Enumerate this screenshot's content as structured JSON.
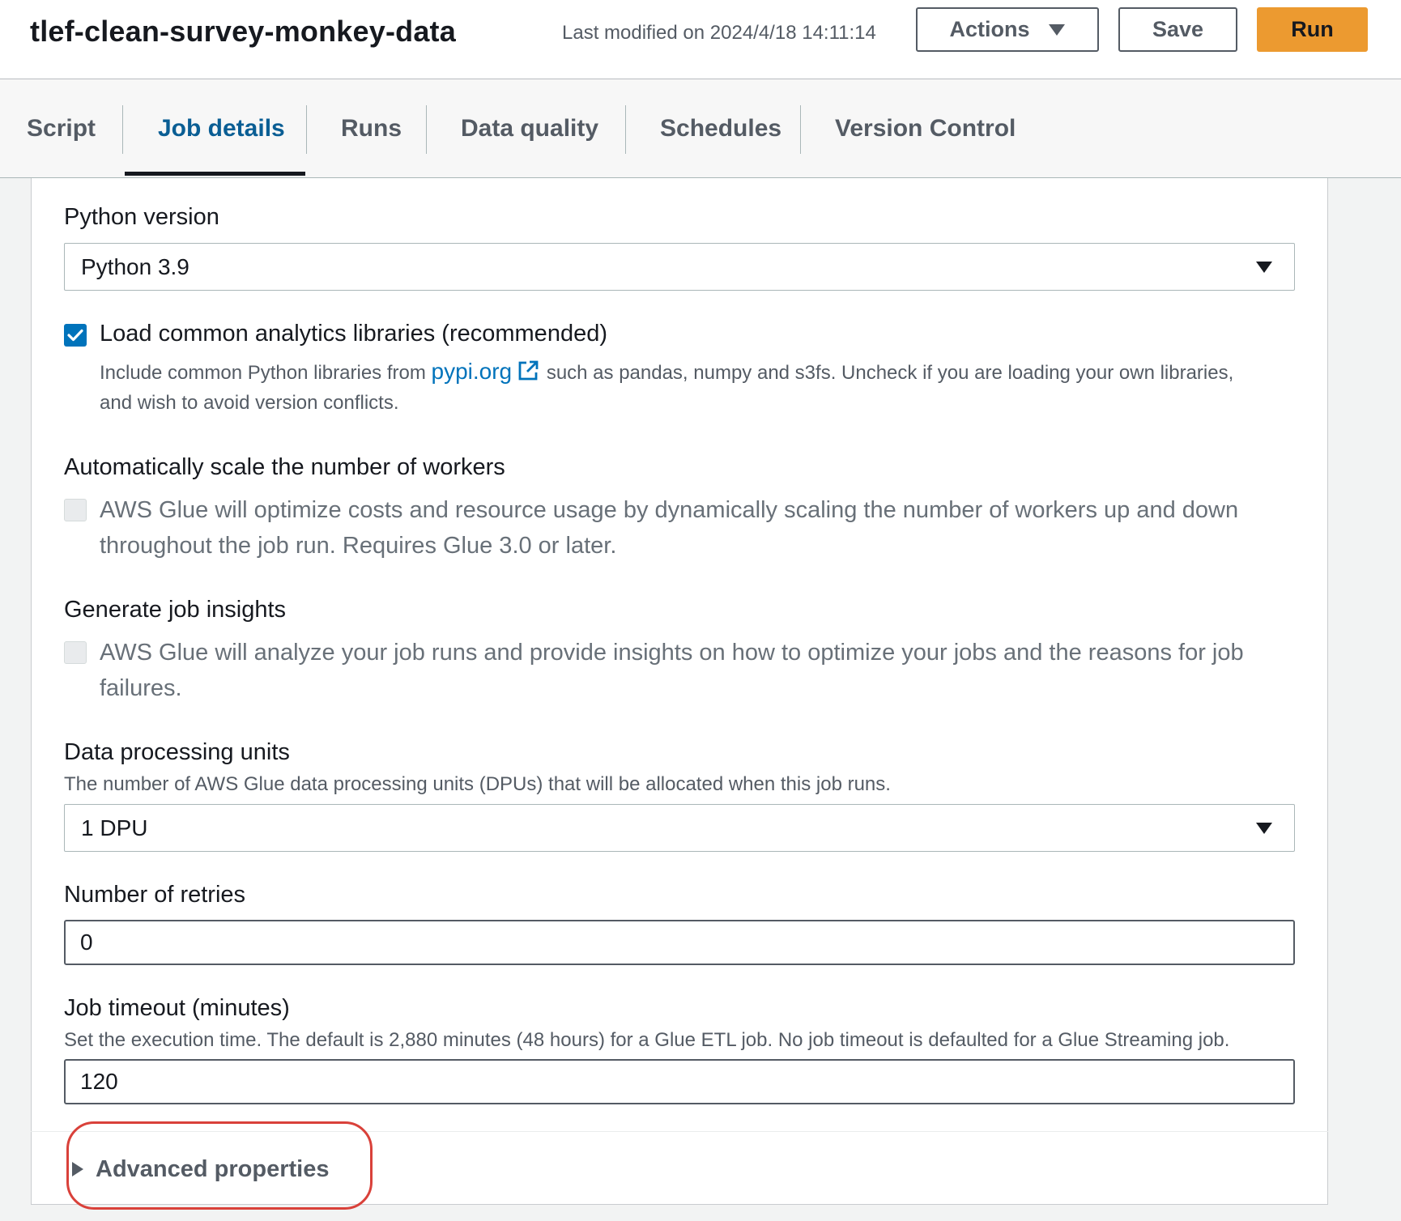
{
  "header": {
    "job_name": "tlef-clean-survey-monkey-data",
    "last_modified": "Last modified on 2024/4/18 14:11:14",
    "actions_label": "Actions",
    "save_label": "Save",
    "run_label": "Run"
  },
  "tabs": [
    {
      "label": "Script",
      "active": false
    },
    {
      "label": "Job details",
      "active": true
    },
    {
      "label": "Runs",
      "active": false
    },
    {
      "label": "Data quality",
      "active": false
    },
    {
      "label": "Schedules",
      "active": false
    },
    {
      "label": "Version Control",
      "active": false
    }
  ],
  "form": {
    "python_version": {
      "label": "Python version",
      "value": "Python 3.9"
    },
    "analytics_libraries": {
      "checked": true,
      "label": "Load common analytics libraries (recommended)",
      "desc_before": "Include common Python libraries from",
      "link_text": "pypi.org",
      "desc_after": "such as pandas, numpy and s3fs. Uncheck if you are loading your own libraries,",
      "desc_line2": "and wish to avoid version conflicts."
    },
    "auto_scale": {
      "label": "Automatically scale the number of workers",
      "checked": false,
      "text_line1": "AWS Glue will optimize costs and resource usage by dynamically scaling the number of workers up and down",
      "text_line2": "throughout the job run. Requires Glue 3.0 or later."
    },
    "job_insights": {
      "label": "Generate job insights",
      "checked": false,
      "text_line1": "AWS Glue will analyze your job runs and provide insights on how to optimize your jobs and the reasons for job",
      "text_line2": "failures."
    },
    "dpu": {
      "label": "Data processing units",
      "desc": "The number of AWS Glue data processing units (DPUs) that will be allocated when this job runs.",
      "value": "1 DPU"
    },
    "retries": {
      "label": "Number of retries",
      "value": "0"
    },
    "timeout": {
      "label": "Job timeout (minutes)",
      "desc": "Set the execution time. The default is 2,880 minutes (48 hours) for a Glue ETL job. No job timeout is defaulted for a Glue Streaming job.",
      "value": "120"
    },
    "advanced_label": "Advanced properties"
  },
  "colors": {
    "accent": "#0073bb",
    "run_button": "#ec9a30",
    "active_tab": "#0a5e94",
    "highlight": "#d9413a"
  },
  "icons": [
    "caret-down-icon",
    "checkmark-icon",
    "external-link-icon",
    "triangle-right-icon"
  ]
}
